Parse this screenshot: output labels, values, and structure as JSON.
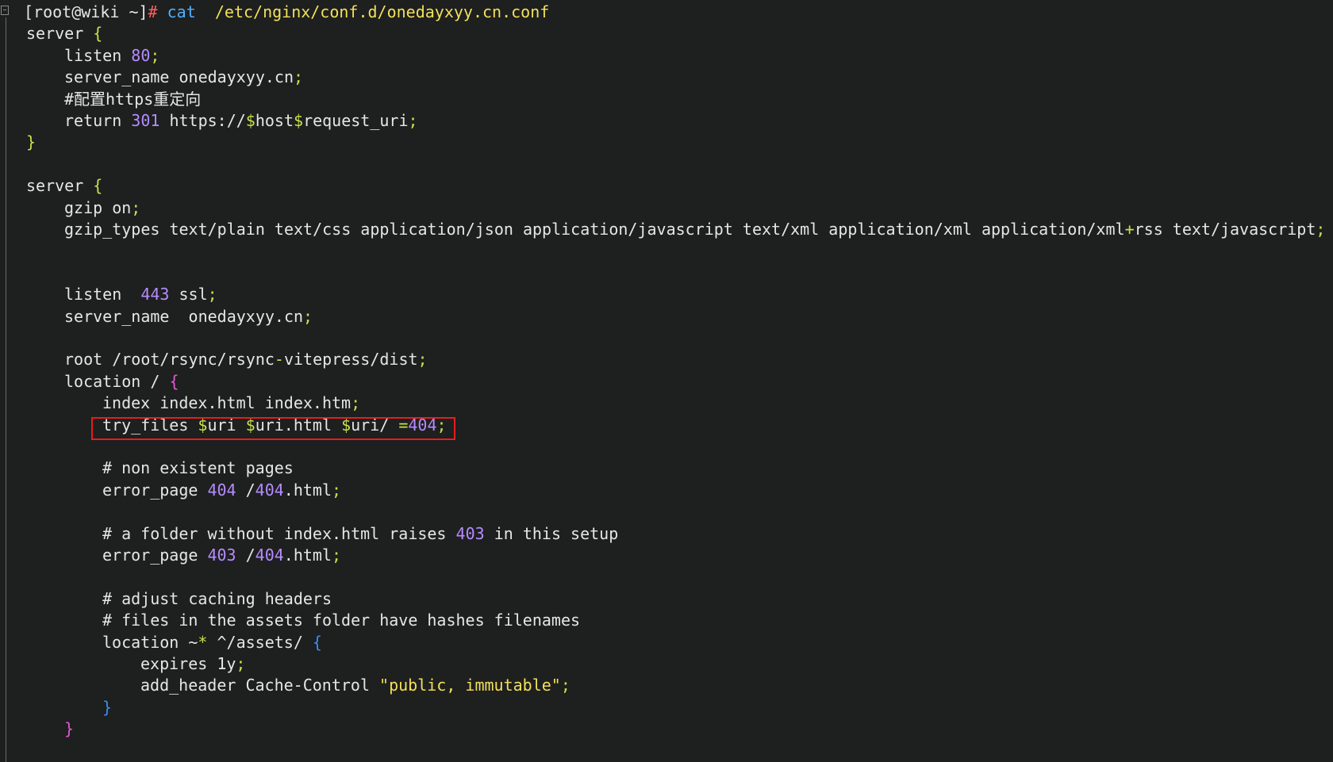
{
  "prompt": {
    "user_host": "[root@wiki ~]",
    "hash": "#",
    "command": "cat",
    "path": "/etc/nginx/conf.d/onedayxyy.cn.conf"
  },
  "lines": [
    {
      "indent": 0,
      "tokens": [
        [
          "w",
          "server "
        ],
        [
          "brc",
          "{"
        ]
      ]
    },
    {
      "indent": 1,
      "tokens": [
        [
          "w",
          "listen "
        ],
        [
          "num",
          "80"
        ],
        [
          "sym",
          ";"
        ]
      ]
    },
    {
      "indent": 1,
      "tokens": [
        [
          "w",
          "server_name onedayxyy.cn"
        ],
        [
          "sym",
          ";"
        ]
      ]
    },
    {
      "indent": 1,
      "tokens": [
        [
          "w",
          "#配置https重定向"
        ]
      ]
    },
    {
      "indent": 1,
      "tokens": [
        [
          "w",
          "return "
        ],
        [
          "num",
          "301"
        ],
        [
          "w",
          " https://"
        ],
        [
          "var",
          "$"
        ],
        [
          "w",
          "host"
        ],
        [
          "var",
          "$"
        ],
        [
          "w",
          "request_uri"
        ],
        [
          "sym",
          ";"
        ]
      ]
    },
    {
      "indent": 0,
      "tokens": [
        [
          "brc",
          "}"
        ]
      ]
    },
    {
      "indent": 0,
      "tokens": []
    },
    {
      "indent": 0,
      "tokens": [
        [
          "w",
          "server "
        ],
        [
          "brc",
          "{"
        ]
      ]
    },
    {
      "indent": 1,
      "tokens": [
        [
          "w",
          "gzip on"
        ],
        [
          "sym",
          ";"
        ]
      ]
    },
    {
      "indent": 1,
      "tokens": [
        [
          "w",
          "gzip_types text/plain text/css application/json application/javascript text/xml application/xml application/xml"
        ],
        [
          "sym",
          "+"
        ],
        [
          "w",
          "rss text/javascript"
        ],
        [
          "sym",
          ";"
        ]
      ]
    },
    {
      "indent": 0,
      "tokens": []
    },
    {
      "indent": 0,
      "tokens": []
    },
    {
      "indent": 1,
      "tokens": [
        [
          "w",
          "listen  "
        ],
        [
          "num",
          "443"
        ],
        [
          "w",
          " ssl"
        ],
        [
          "sym",
          ";"
        ]
      ]
    },
    {
      "indent": 1,
      "tokens": [
        [
          "w",
          "server_name  onedayxyy.cn"
        ],
        [
          "sym",
          ";"
        ]
      ]
    },
    {
      "indent": 0,
      "tokens": []
    },
    {
      "indent": 1,
      "tokens": [
        [
          "w",
          "root /root/rsync/rsync"
        ],
        [
          "sym",
          "-"
        ],
        [
          "w",
          "vitepress/dist"
        ],
        [
          "sym",
          ";"
        ]
      ]
    },
    {
      "indent": 1,
      "tokens": [
        [
          "w",
          "location / "
        ],
        [
          "mag",
          "{"
        ]
      ]
    },
    {
      "indent": 2,
      "tokens": [
        [
          "w",
          "index index.html index.htm"
        ],
        [
          "sym",
          ";"
        ]
      ]
    },
    {
      "indent": 2,
      "tokens": [
        [
          "w",
          "try_files "
        ],
        [
          "var",
          "$"
        ],
        [
          "w",
          "uri "
        ],
        [
          "var",
          "$"
        ],
        [
          "w",
          "uri.html "
        ],
        [
          "var",
          "$"
        ],
        [
          "w",
          "uri/ "
        ],
        [
          "sym",
          "="
        ],
        [
          "num",
          "404"
        ],
        [
          "sym",
          ";"
        ]
      ]
    },
    {
      "indent": 0,
      "tokens": []
    },
    {
      "indent": 2,
      "tokens": [
        [
          "w",
          "# non existent pages"
        ]
      ]
    },
    {
      "indent": 2,
      "tokens": [
        [
          "w",
          "error_page "
        ],
        [
          "num",
          "404"
        ],
        [
          "w",
          " /"
        ],
        [
          "num",
          "404"
        ],
        [
          "w",
          ".html"
        ],
        [
          "sym",
          ";"
        ]
      ]
    },
    {
      "indent": 0,
      "tokens": []
    },
    {
      "indent": 2,
      "tokens": [
        [
          "w",
          "# a folder without index.html raises "
        ],
        [
          "num",
          "403"
        ],
        [
          "w",
          " in this setup"
        ]
      ]
    },
    {
      "indent": 2,
      "tokens": [
        [
          "w",
          "error_page "
        ],
        [
          "num",
          "403"
        ],
        [
          "w",
          " /"
        ],
        [
          "num",
          "404"
        ],
        [
          "w",
          ".html"
        ],
        [
          "sym",
          ";"
        ]
      ]
    },
    {
      "indent": 0,
      "tokens": []
    },
    {
      "indent": 2,
      "tokens": [
        [
          "w",
          "# adjust caching headers"
        ]
      ]
    },
    {
      "indent": 2,
      "tokens": [
        [
          "w",
          "# files in the assets folder have hashes filenames"
        ]
      ]
    },
    {
      "indent": 2,
      "tokens": [
        [
          "w",
          "location ~"
        ],
        [
          "sym",
          "*"
        ],
        [
          "w",
          " ^/assets/ "
        ],
        [
          "blu",
          "{"
        ]
      ]
    },
    {
      "indent": 3,
      "tokens": [
        [
          "w",
          "expires 1y"
        ],
        [
          "sym",
          ";"
        ]
      ]
    },
    {
      "indent": 3,
      "tokens": [
        [
          "w",
          "add_header Cache-Control "
        ],
        [
          "str",
          "\"public, immutable\""
        ],
        [
          "sym",
          ";"
        ]
      ]
    },
    {
      "indent": 2,
      "tokens": [
        [
          "blu",
          "}"
        ]
      ]
    },
    {
      "indent": 1,
      "tokens": [
        [
          "mag",
          "}"
        ]
      ]
    }
  ],
  "colors": {
    "background": "#1e1f1f",
    "text": "#e6e6e6",
    "number": "#b58cff",
    "punctuation": "#c5e04a",
    "string": "#f1e05a",
    "command": "#4fb0ff",
    "highlight_border": "#e51e1e"
  },
  "icons": {
    "fold": "fold-collapse-icon"
  }
}
